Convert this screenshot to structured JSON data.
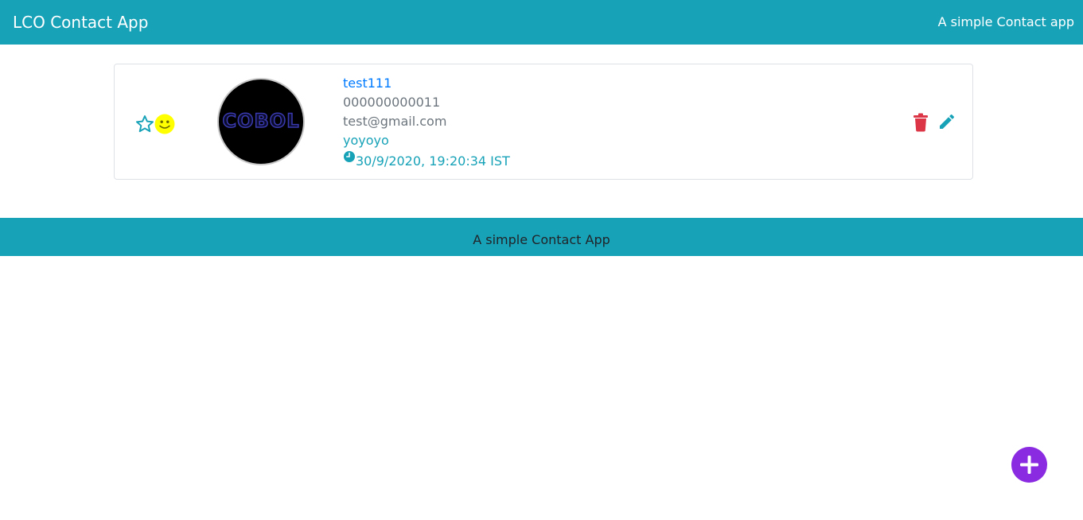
{
  "navbar": {
    "brand": "LCO Contact App",
    "tagline": "A simple Contact app",
    "background": "#17a2b8"
  },
  "contacts": [
    {
      "name": "test111",
      "phone": "000000000011",
      "email": "test@gmail.com",
      "address": "yoyoyo",
      "timestamp": "30/9/2020, 19:20:34 IST",
      "avatar_text": "COBOL",
      "icons": [
        "star-outline-icon",
        "smiley-icon",
        "clock-icon",
        "trash-icon",
        "pencil-icon"
      ]
    }
  ],
  "footer": {
    "text": "A simple Contact App"
  },
  "fab": {
    "icon": "plus-icon",
    "color": "#8a2be2"
  },
  "colors": {
    "primary": "#17a2b8",
    "link": "#007bff",
    "muted": "#6c757d",
    "danger": "#dc3545",
    "warning": "#ffff00"
  }
}
